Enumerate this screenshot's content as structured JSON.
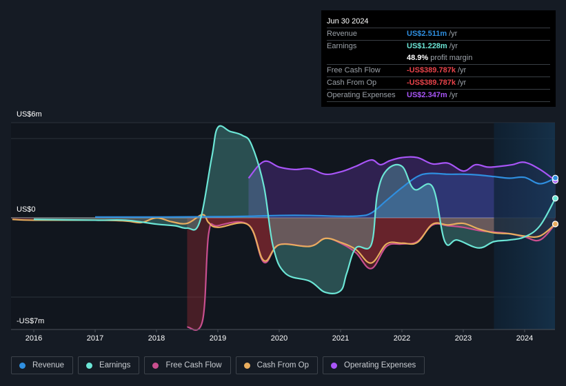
{
  "tooltip": {
    "date": "Jun 30 2024",
    "rows": [
      {
        "label": "Revenue",
        "value": "US$2.511m",
        "unit": "/yr",
        "color": "#2f8fe0"
      },
      {
        "label": "Earnings",
        "value": "US$1.228m",
        "unit": "/yr",
        "color": "#6ce6d6"
      },
      {
        "label": "",
        "value": "48.9%",
        "unit": "profit margin",
        "color": "#ffffff"
      },
      {
        "label": "Free Cash Flow",
        "value": "-US$389.787k",
        "unit": "/yr",
        "color": "#e8434a"
      },
      {
        "label": "Cash From Op",
        "value": "-US$389.787k",
        "unit": "/yr",
        "color": "#e8434a"
      },
      {
        "label": "Operating Expenses",
        "value": "US$2.347m",
        "unit": "/yr",
        "color": "#a855f7"
      }
    ]
  },
  "legend": [
    {
      "label": "Revenue",
      "color": "#2f8fe0"
    },
    {
      "label": "Earnings",
      "color": "#6ce6d6"
    },
    {
      "label": "Free Cash Flow",
      "color": "#c94f8f"
    },
    {
      "label": "Cash From Op",
      "color": "#e9ad5e"
    },
    {
      "label": "Operating Expenses",
      "color": "#a855f7"
    }
  ],
  "chart_data": {
    "type": "area",
    "title": "",
    "xlabel": "",
    "ylabel": "",
    "y_tick_labels": [
      {
        "label": "US$6m",
        "value": 6
      },
      {
        "label": "US$0",
        "value": 0
      },
      {
        "label": "-US$7m",
        "value": -7
      }
    ],
    "x_tick_labels": [
      "2016",
      "2017",
      "2018",
      "2019",
      "2020",
      "2021",
      "2022",
      "2023",
      "2024"
    ],
    "xlim": [
      2015.65,
      2024.5
    ],
    "ylim": [
      -7,
      6
    ],
    "units": "US$ millions",
    "highlight_range": [
      2023.5,
      2024.5
    ],
    "grid": true,
    "series": [
      {
        "name": "Revenue",
        "color": "#2f8fe0",
        "x": [
          2017.0,
          2018.0,
          2019.0,
          2019.5,
          2020.0,
          2020.5,
          2021.0,
          2021.3,
          2021.5,
          2021.75,
          2022.0,
          2022.25,
          2022.45,
          2022.75,
          2023.0,
          2023.25,
          2023.5,
          2023.75,
          2024.0,
          2024.25,
          2024.5
        ],
        "values": [
          0.05,
          0.05,
          0.07,
          0.1,
          0.15,
          0.15,
          0.1,
          0.12,
          0.3,
          1.1,
          1.9,
          2.6,
          2.8,
          2.75,
          2.75,
          2.7,
          2.6,
          2.5,
          2.55,
          2.15,
          2.511
        ]
      },
      {
        "name": "Earnings",
        "color": "#6ce6d6",
        "x": [
          2016.0,
          2017.0,
          2017.5,
          2018.0,
          2018.3,
          2018.5,
          2018.7,
          2018.9,
          2019.0,
          2019.2,
          2019.4,
          2019.55,
          2019.75,
          2019.9,
          2020.1,
          2020.5,
          2020.75,
          2021.0,
          2021.1,
          2021.25,
          2021.5,
          2021.6,
          2021.75,
          2022.0,
          2022.2,
          2022.5,
          2022.7,
          2022.9,
          2023.25,
          2023.5,
          2023.75,
          2024.0,
          2024.25,
          2024.5
        ],
        "values": [
          -0.1,
          -0.15,
          -0.15,
          -0.4,
          -0.5,
          -0.65,
          -0.3,
          3.8,
          5.7,
          5.45,
          5.2,
          4.6,
          2.0,
          -1.8,
          -3.5,
          -4.0,
          -4.7,
          -4.6,
          -3.5,
          -1.9,
          -1.7,
          1.5,
          3.0,
          3.25,
          1.8,
          1.95,
          -1.5,
          -1.4,
          -1.9,
          -1.5,
          -1.4,
          -1.2,
          -0.5,
          1.228
        ]
      },
      {
        "name": "Free Cash Flow",
        "color": "#c94f8f",
        "x": [
          2018.5,
          2018.75,
          2018.85,
          2019.0,
          2019.5,
          2019.75,
          2020.0,
          2020.5,
          2020.75,
          2021.0,
          2021.25,
          2021.5,
          2021.75,
          2022.0,
          2022.25,
          2022.5,
          2022.75,
          2023.0,
          2023.25,
          2023.5,
          2023.75,
          2024.0,
          2024.25,
          2024.5
        ],
        "values": [
          -6.9,
          -6.5,
          -1.0,
          -0.5,
          -0.45,
          -2.8,
          -1.7,
          -1.8,
          -1.3,
          -1.6,
          -2.2,
          -3.2,
          -1.8,
          -1.65,
          -1.5,
          -0.45,
          -0.5,
          -0.6,
          -0.8,
          -0.9,
          -1.0,
          -1.2,
          -1.4,
          -0.39
        ]
      },
      {
        "name": "Cash From Op",
        "color": "#e9ad5e",
        "x": [
          2015.65,
          2016.0,
          2017.0,
          2017.5,
          2017.75,
          2018.0,
          2018.25,
          2018.5,
          2018.75,
          2018.85,
          2019.0,
          2019.5,
          2019.75,
          2020.0,
          2020.5,
          2020.75,
          2021.0,
          2021.25,
          2021.5,
          2021.75,
          2022.0,
          2022.25,
          2022.5,
          2022.75,
          2023.0,
          2023.25,
          2023.5,
          2023.75,
          2024.0,
          2024.25,
          2024.5
        ],
        "values": [
          -0.1,
          -0.15,
          -0.15,
          -0.2,
          -0.3,
          0.0,
          -0.25,
          -0.35,
          0.2,
          -0.3,
          -0.6,
          -0.45,
          -2.7,
          -1.7,
          -1.8,
          -1.3,
          -1.55,
          -2.0,
          -2.85,
          -1.65,
          -1.6,
          -1.55,
          -0.4,
          -0.45,
          -0.35,
          -0.7,
          -0.95,
          -1.0,
          -1.15,
          -1.15,
          -0.39
        ]
      },
      {
        "name": "Operating Expenses",
        "color": "#a855f7",
        "x": [
          2019.5,
          2019.75,
          2020.0,
          2020.25,
          2020.5,
          2020.75,
          2021.0,
          2021.25,
          2021.5,
          2021.65,
          2021.8,
          2022.0,
          2022.25,
          2022.5,
          2022.75,
          2023.0,
          2023.2,
          2023.4,
          2023.6,
          2023.8,
          2024.0,
          2024.25,
          2024.5
        ],
        "values": [
          2.5,
          3.55,
          3.2,
          3.05,
          3.1,
          2.75,
          2.9,
          3.25,
          3.65,
          3.35,
          3.6,
          3.8,
          3.8,
          3.4,
          3.45,
          2.95,
          3.35,
          3.2,
          3.25,
          3.35,
          3.5,
          3.05,
          2.347
        ]
      }
    ]
  }
}
